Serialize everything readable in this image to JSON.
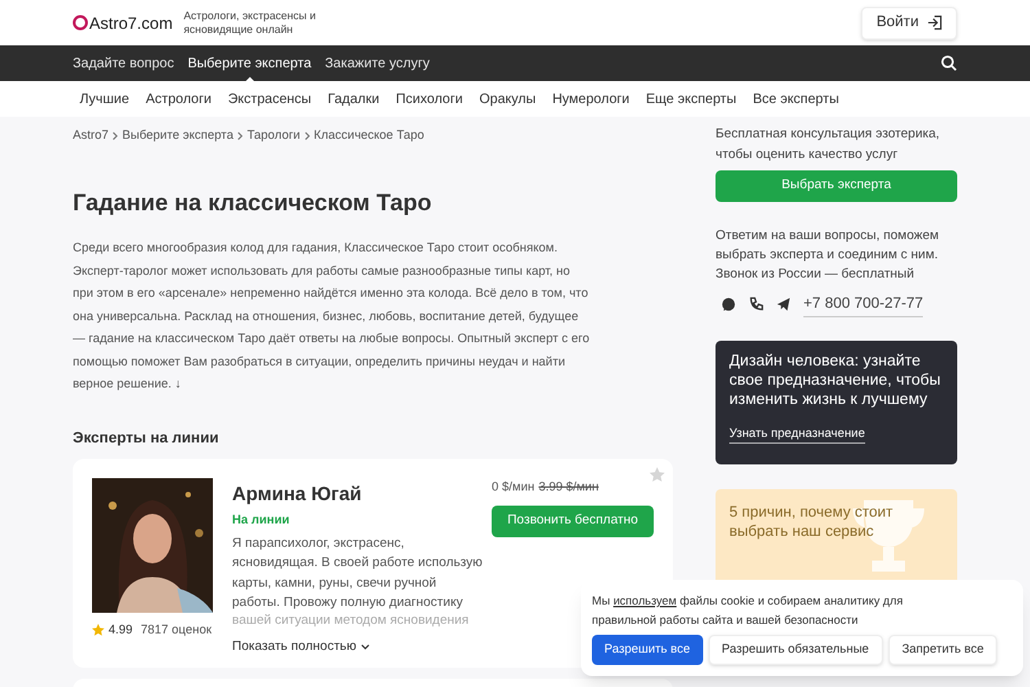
{
  "header": {
    "logo": "Astro7.com",
    "tagline": "Астрологи, экстрасенсы и ясновидящие онлайн",
    "login": "Войти"
  },
  "main_nav": [
    {
      "label": "Задайте вопрос",
      "selected": false
    },
    {
      "label": "Выберите эксперта",
      "selected": true
    },
    {
      "label": "Закажите услугу",
      "selected": false
    }
  ],
  "sub_nav": [
    "Лучшие",
    "Астрологи",
    "Экстрасенсы",
    "Гадалки",
    "Психологи",
    "Оракулы",
    "Нумерологи",
    "Еще эксперты",
    "Все эксперты"
  ],
  "breadcrumbs": [
    "Astro7",
    "Выберите эксперта",
    "Тарологи",
    "Классическое Таро"
  ],
  "title": "Гадание на классическом Таро",
  "intro": "Среди всего многообразия колод для гадания, Классическое Таро стоит особняком. Эксперт-таролог может использовать для работы самые разнообразные типы карт, но при этом в его «арсенале» непременно найдётся именно эта колода. Всё дело в том, что она универсальна. Расклад на отношения, бизнес, любовь, воспитание детей, будущее — гадание на классическом Таро даёт ответы на любые вопросы. Опытный эксперт с его помощью поможет Вам разобраться в ситуации, определить причины неудач и найти верное решение. ↓",
  "experts_heading": "Эксперты на линии",
  "experts": [
    {
      "name": "Армина Югай",
      "status": "На линии",
      "online": true,
      "favorite": false,
      "description": "Я парапсихолог, экстрасенс, ясновидящая. В своей работе использую карты, камни, руны, свечи ручной работы. Провожу полную диагностику",
      "description_faded": "вашей ситуации методом ясновидения",
      "rating": "4.99",
      "reviews": "7817 оценок",
      "more": "Показать полностью",
      "price": "0 $/мин",
      "old_price": "3.99 $/мин",
      "call": "Позвонить бесплатно"
    }
  ],
  "sidebar": {
    "consult_text": "Бесплатная консультация эзотерика, чтобы оценить качество услуг",
    "choose": "Выбрать эксперта",
    "contact_text": "Ответим на ваши вопросы, поможем выбрать эксперта и соединим с ним. Звонок из России — бесплатный",
    "phone": "+7 800 700-27-77",
    "promo_dark": {
      "title": "Дизайн человека: узнайте свое предназначение, чтобы изменить жизнь к лучшему",
      "link": "Узнать предназначение"
    },
    "promo_light": {
      "title": "5 причин, почему стоит выбрать наш сервис"
    }
  },
  "cookie": {
    "text": "Мы **используем** файлы cookie и собираем аналитику для правильной работы сайта и вашей безопасности",
    "buttons": [
      {
        "label": "Разрешить все",
        "kind": "primary"
      },
      {
        "label": "Разрешить обязательные",
        "kind": "secondary"
      },
      {
        "label": "Запретить все",
        "kind": "secondary"
      }
    ]
  }
}
